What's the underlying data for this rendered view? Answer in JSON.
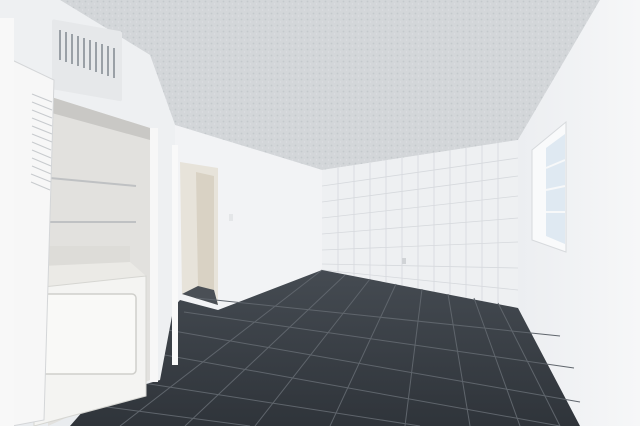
{
  "scene": {
    "description_tag": "empty-room-interior",
    "colors": {
      "ceiling": "#d3d6d9",
      "wall_light": "#f2f3f5",
      "wall_shadow": "#e1e3e6",
      "tile_wall": "#eef0f2",
      "floor": "#3a3f45",
      "grout": "#6b7077",
      "washer": "#f4f4f2",
      "door_trim": "#f7f7f7",
      "window_glass": "#dfe9f2"
    }
  }
}
